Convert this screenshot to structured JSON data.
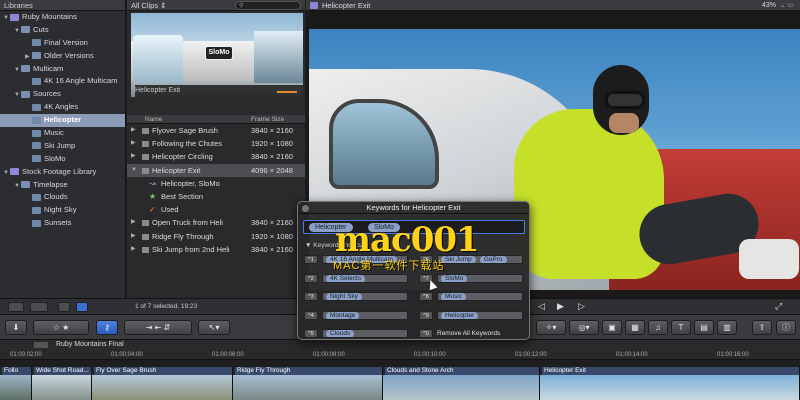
{
  "libraries": {
    "header": "Libraries",
    "items": [
      {
        "label": "Ruby Mountains",
        "level": 0,
        "icon": "library-icon",
        "expanded": true
      },
      {
        "label": "Cuts",
        "level": 1,
        "icon": "folder-icon",
        "expanded": true
      },
      {
        "label": "Final Version",
        "level": 2,
        "icon": "keyword-icon"
      },
      {
        "label": "Older Versions",
        "level": 2,
        "icon": "folder-icon",
        "expanded": false
      },
      {
        "label": "Multicam",
        "level": 1,
        "icon": "folder-icon",
        "expanded": true
      },
      {
        "label": "4K 16 Angle Multicam",
        "level": 2,
        "icon": "keyword-icon"
      },
      {
        "label": "Sources",
        "level": 1,
        "icon": "folder-icon",
        "expanded": true
      },
      {
        "label": "4K Angles",
        "level": 2,
        "icon": "keyword-icon"
      },
      {
        "label": "Helicopter",
        "level": 2,
        "icon": "keyword-icon",
        "selected": true
      },
      {
        "label": "Music",
        "level": 2,
        "icon": "keyword-icon"
      },
      {
        "label": "Ski Jump",
        "level": 2,
        "icon": "keyword-icon"
      },
      {
        "label": "SloMo",
        "level": 2,
        "icon": "keyword-icon"
      },
      {
        "label": "Stock Footage Library",
        "level": 0,
        "icon": "library-icon",
        "expanded": true
      },
      {
        "label": "Timelapse",
        "level": 1,
        "icon": "folder-icon",
        "expanded": true
      },
      {
        "label": "Clouds",
        "level": 2,
        "icon": "keyword-icon"
      },
      {
        "label": "Night Sky",
        "level": 2,
        "icon": "keyword-icon"
      },
      {
        "label": "Sunsets",
        "level": 2,
        "icon": "keyword-icon"
      }
    ]
  },
  "browser": {
    "filter": "All Clips ⇕",
    "filmstrip_tag": "SloMo",
    "filmstrip_caption": "Helicopter Exit",
    "columns": {
      "name": "Name",
      "frame_size": "Frame Size"
    },
    "clips": [
      {
        "name": "Flyover Sage Brush",
        "frame_size": "3840 × 2160"
      },
      {
        "name": "Following the Chutes",
        "frame_size": "1920 × 1080"
      },
      {
        "name": "Helicopter Circling",
        "frame_size": "3840 × 2160"
      },
      {
        "name": "Helicopter Exit",
        "frame_size": "4096 × 2048",
        "selected": true,
        "expanded": true
      },
      {
        "name": "Helicopter, SloMo",
        "sub": true,
        "icon": "↝"
      },
      {
        "name": "Best Section",
        "sub": true,
        "icon": "★"
      },
      {
        "name": "Used",
        "sub": true,
        "icon": "✓"
      },
      {
        "name": "Open Truck from Heli",
        "frame_size": "3840 × 2160"
      },
      {
        "name": "Ridge Fly Through",
        "frame_size": "1920 × 1080"
      },
      {
        "name": "Ski Jump from 2nd Heli",
        "frame_size": "3840 × 2160"
      }
    ],
    "status": "1 of 7 selected, 19:23"
  },
  "viewer": {
    "title": "Helicopter Exit",
    "zoom": "43%",
    "view_menu": "⌄ ▭"
  },
  "timeline": {
    "project": "Ruby Mountains Final",
    "ticks": [
      "01:00:02:00",
      "01:00:04:00",
      "01:00:06:00",
      "01:00:08:00",
      "01:00:10:00",
      "01:00:12:00",
      "01:00:14:00",
      "01:00:16:00"
    ],
    "clips": [
      {
        "label": "Follo"
      },
      {
        "label": "Wide Shot Road..."
      },
      {
        "label": "Fly Over Sage Brush"
      },
      {
        "label": "Ridge Fly Through"
      },
      {
        "label": "Clouds and Stone Arch"
      },
      {
        "label": "Helicopter Exit"
      }
    ]
  },
  "keywords_hud": {
    "title": "Keywords for Helicopter Exit",
    "tokens": [
      "Helicopter",
      "SloMo"
    ],
    "shortcuts_label": "Keyword Shortcuts",
    "left": [
      {
        "key": "^1",
        "value": "4K 16 Angle Multicam"
      },
      {
        "key": "^2",
        "value": "4K Selects"
      },
      {
        "key": "^3",
        "value": "Night Sky"
      },
      {
        "key": "^4",
        "value": "Montage"
      },
      {
        "key": "^5",
        "value": "Clouds"
      }
    ],
    "right": [
      {
        "key": "^6",
        "value": "Ski Jump",
        "extra": "GoPro"
      },
      {
        "key": "^7",
        "value": "SloMo"
      },
      {
        "key": "^8",
        "value": "Music"
      },
      {
        "key": "^9",
        "value": "Helicopter"
      },
      {
        "key": "^0",
        "value": "Remove All Keywords",
        "plain": true
      }
    ]
  },
  "watermark": {
    "line1": "mac001",
    "line2": "MAC第一软件下载站"
  },
  "colors": {
    "selection": "#8c9bb5",
    "accent_blue": "#3b6fd4",
    "keyword_pill": "#8aa0c8",
    "watermark": "#ffd21a"
  }
}
